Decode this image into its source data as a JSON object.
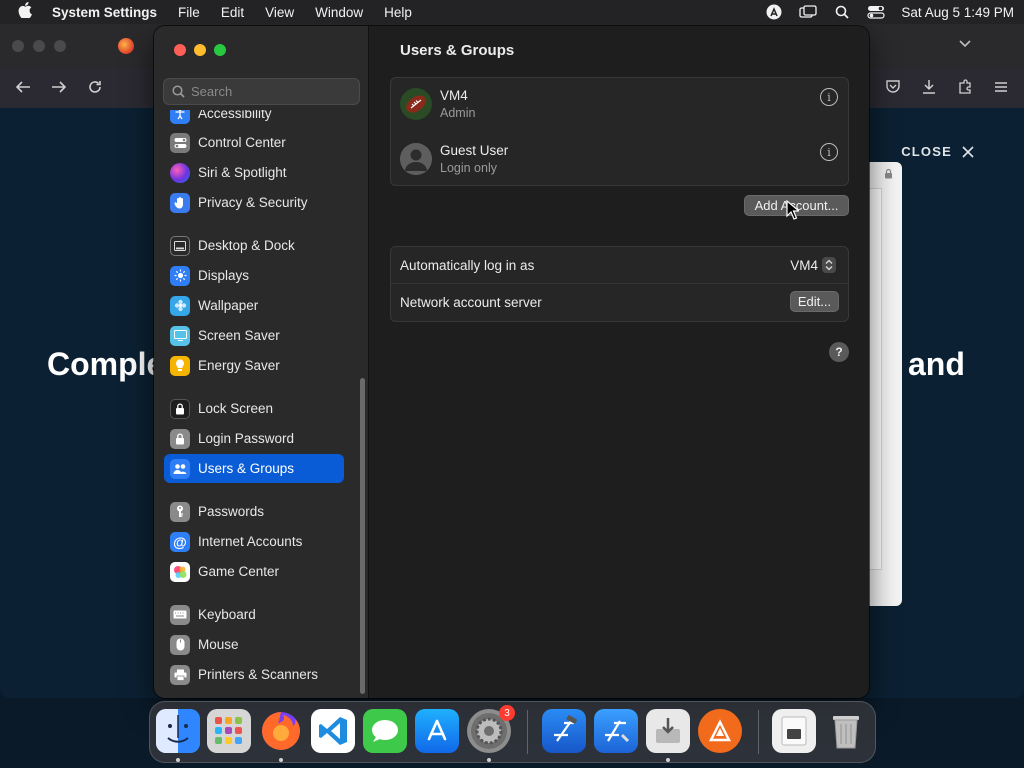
{
  "menubar": {
    "app_name": "System Settings",
    "items": [
      "File",
      "Edit",
      "View",
      "Window",
      "Help"
    ],
    "clock": "Sat Aug 5  1:49 PM"
  },
  "browser": {
    "close_label": "CLOSE",
    "headline_left": "Comple",
    "headline_right": "and"
  },
  "settings": {
    "search_placeholder": "Search",
    "sidebar": {
      "partial_top": "Accessibility",
      "items": [
        {
          "label": "Control Center",
          "icon": "control-center-icon",
          "color": "#7a7a7a"
        },
        {
          "label": "Siri & Spotlight",
          "icon": "siri-icon",
          "color": "#8a3ce0"
        },
        {
          "label": "Privacy & Security",
          "icon": "hand-icon",
          "color": "#3a7bf0"
        },
        {
          "label": "Desktop & Dock",
          "icon": "dock-icon",
          "color": "#2a2a2a"
        },
        {
          "label": "Displays",
          "icon": "sun-icon",
          "color": "#2f7ef5"
        },
        {
          "label": "Wallpaper",
          "icon": "flower-icon",
          "color": "#35a6e8"
        },
        {
          "label": "Screen Saver",
          "icon": "screen-saver-icon",
          "color": "#56c2e8"
        },
        {
          "label": "Energy Saver",
          "icon": "battery-icon",
          "color": "#f5b400"
        },
        {
          "label": "Lock Screen",
          "icon": "lock-icon",
          "color": "#1e1e1e"
        },
        {
          "label": "Login Password",
          "icon": "lock-icon",
          "color": "#8a8a8a"
        },
        {
          "label": "Users & Groups",
          "icon": "users-icon",
          "color": "#2f7ef5"
        },
        {
          "label": "Passwords",
          "icon": "key-icon",
          "color": "#8a8a8a"
        },
        {
          "label": "Internet Accounts",
          "icon": "at-icon",
          "color": "#2f7ef5"
        },
        {
          "label": "Game Center",
          "icon": "game-center-icon",
          "color": "#ffffff"
        },
        {
          "label": "Keyboard",
          "icon": "keyboard-icon",
          "color": "#8a8a8a"
        },
        {
          "label": "Mouse",
          "icon": "mouse-icon",
          "color": "#8a8a8a"
        },
        {
          "label": "Printers & Scanners",
          "icon": "printer-icon",
          "color": "#8a8a8a"
        }
      ],
      "selected": "Users & Groups"
    },
    "main": {
      "title": "Users & Groups",
      "users": [
        {
          "name": "VM4",
          "role": "Admin",
          "avatar": "football-icon"
        },
        {
          "name": "Guest User",
          "role": "Login only",
          "avatar": "person-icon"
        }
      ],
      "add_account_label": "Add Account...",
      "auto_login_label": "Automatically log in as",
      "auto_login_value": "VM4",
      "network_server_label": "Network account server",
      "edit_label": "Edit...",
      "help_label": "?"
    }
  },
  "dock": {
    "apps": [
      "finder-icon",
      "launchpad-icon",
      "firefox-icon",
      "vscode-icon",
      "messages-icon",
      "app-store-icon",
      "system-settings-icon",
      "xcode-icon",
      "simulator-icon",
      "installer-icon",
      "transmit-icon",
      "downloads-icon",
      "trash-icon"
    ],
    "settings_badge": "3"
  },
  "colors": {
    "accent": "#0a5bd6",
    "traffic_red": "#fe5f57",
    "traffic_yellow": "#febc2e",
    "traffic_green": "#28c840"
  }
}
